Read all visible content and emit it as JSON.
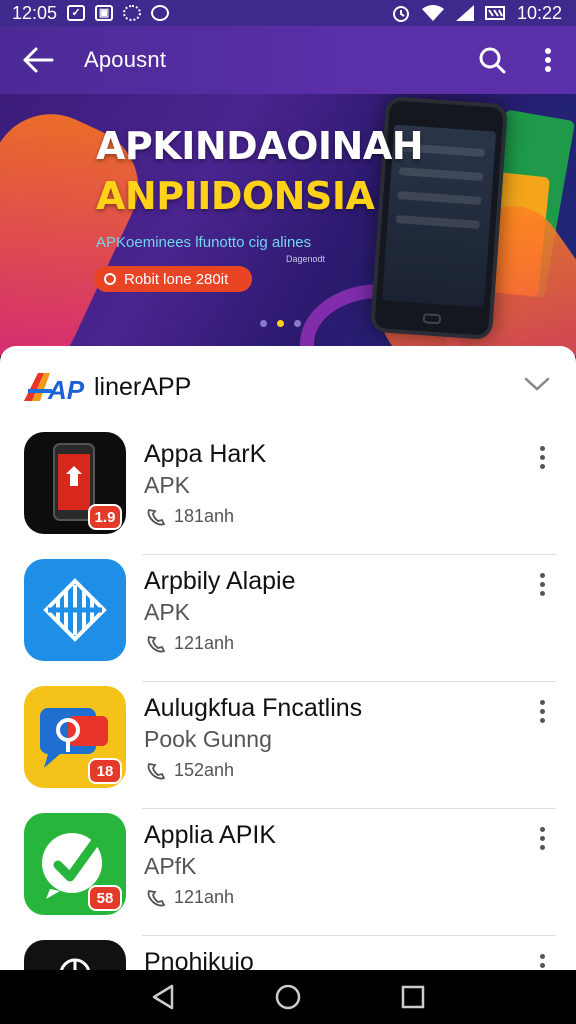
{
  "status_bar": {
    "time_left": "12:05",
    "time_right": "10:22"
  },
  "toolbar": {
    "title": "Apousnt"
  },
  "banner": {
    "line1": "APKINDAOINAH",
    "line2": "ANPIIDONSIA",
    "tagline": "APKoeminees lfunotto cig alines",
    "small_text": "Dagenodt",
    "pill_text": "Robit lone 280it",
    "page_count": 3,
    "active_page": 2
  },
  "section": {
    "logo_text": "AP",
    "title": "linerAPP"
  },
  "apps": [
    {
      "name": "Appa HarK",
      "subtitle": "APK",
      "meta": "181anh",
      "badge": "1.9",
      "icon_color": "#0d0d0d",
      "icon": "phone-app-icon"
    },
    {
      "name": "Arpbily Alapie",
      "subtitle": "APK",
      "meta": "121anh",
      "badge": "",
      "icon_color": "#1e8ee6",
      "icon": "striped-globe-icon"
    },
    {
      "name": "Aulugkfua Fncatlins",
      "subtitle": "Pook Gunng",
      "meta": "152anh",
      "badge": "18",
      "icon_color": "#f5c21a",
      "icon": "chat-bubble-icon"
    },
    {
      "name": "Applia APIK",
      "subtitle": "APfK",
      "meta": "121anh",
      "badge": "58",
      "icon_color": "#27b53c",
      "icon": "check-bubble-icon"
    },
    {
      "name": "Pnohikuio",
      "subtitle": "",
      "meta": "",
      "badge": "",
      "icon_color": "#111111",
      "icon": "globe-icon"
    }
  ],
  "colors": {
    "toolbar": "#4b2a96",
    "accent_yellow": "#ffd21a",
    "badge_red": "#e33a2a"
  }
}
